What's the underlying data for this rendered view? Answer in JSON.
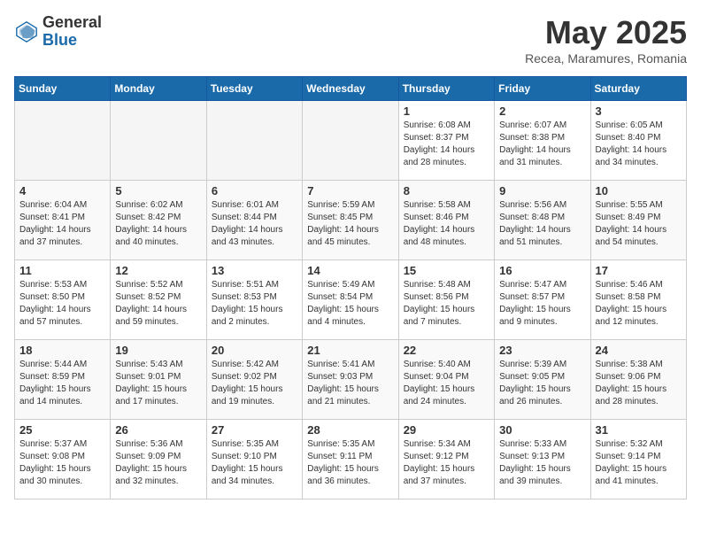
{
  "header": {
    "logo_general": "General",
    "logo_blue": "Blue",
    "month_year": "May 2025",
    "location": "Recea, Maramures, Romania"
  },
  "weekdays": [
    "Sunday",
    "Monday",
    "Tuesday",
    "Wednesday",
    "Thursday",
    "Friday",
    "Saturday"
  ],
  "weeks": [
    [
      {
        "day": "",
        "info": ""
      },
      {
        "day": "",
        "info": ""
      },
      {
        "day": "",
        "info": ""
      },
      {
        "day": "",
        "info": ""
      },
      {
        "day": "1",
        "info": "Sunrise: 6:08 AM\nSunset: 8:37 PM\nDaylight: 14 hours\nand 28 minutes."
      },
      {
        "day": "2",
        "info": "Sunrise: 6:07 AM\nSunset: 8:38 PM\nDaylight: 14 hours\nand 31 minutes."
      },
      {
        "day": "3",
        "info": "Sunrise: 6:05 AM\nSunset: 8:40 PM\nDaylight: 14 hours\nand 34 minutes."
      }
    ],
    [
      {
        "day": "4",
        "info": "Sunrise: 6:04 AM\nSunset: 8:41 PM\nDaylight: 14 hours\nand 37 minutes."
      },
      {
        "day": "5",
        "info": "Sunrise: 6:02 AM\nSunset: 8:42 PM\nDaylight: 14 hours\nand 40 minutes."
      },
      {
        "day": "6",
        "info": "Sunrise: 6:01 AM\nSunset: 8:44 PM\nDaylight: 14 hours\nand 43 minutes."
      },
      {
        "day": "7",
        "info": "Sunrise: 5:59 AM\nSunset: 8:45 PM\nDaylight: 14 hours\nand 45 minutes."
      },
      {
        "day": "8",
        "info": "Sunrise: 5:58 AM\nSunset: 8:46 PM\nDaylight: 14 hours\nand 48 minutes."
      },
      {
        "day": "9",
        "info": "Sunrise: 5:56 AM\nSunset: 8:48 PM\nDaylight: 14 hours\nand 51 minutes."
      },
      {
        "day": "10",
        "info": "Sunrise: 5:55 AM\nSunset: 8:49 PM\nDaylight: 14 hours\nand 54 minutes."
      }
    ],
    [
      {
        "day": "11",
        "info": "Sunrise: 5:53 AM\nSunset: 8:50 PM\nDaylight: 14 hours\nand 57 minutes."
      },
      {
        "day": "12",
        "info": "Sunrise: 5:52 AM\nSunset: 8:52 PM\nDaylight: 14 hours\nand 59 minutes."
      },
      {
        "day": "13",
        "info": "Sunrise: 5:51 AM\nSunset: 8:53 PM\nDaylight: 15 hours\nand 2 minutes."
      },
      {
        "day": "14",
        "info": "Sunrise: 5:49 AM\nSunset: 8:54 PM\nDaylight: 15 hours\nand 4 minutes."
      },
      {
        "day": "15",
        "info": "Sunrise: 5:48 AM\nSunset: 8:56 PM\nDaylight: 15 hours\nand 7 minutes."
      },
      {
        "day": "16",
        "info": "Sunrise: 5:47 AM\nSunset: 8:57 PM\nDaylight: 15 hours\nand 9 minutes."
      },
      {
        "day": "17",
        "info": "Sunrise: 5:46 AM\nSunset: 8:58 PM\nDaylight: 15 hours\nand 12 minutes."
      }
    ],
    [
      {
        "day": "18",
        "info": "Sunrise: 5:44 AM\nSunset: 8:59 PM\nDaylight: 15 hours\nand 14 minutes."
      },
      {
        "day": "19",
        "info": "Sunrise: 5:43 AM\nSunset: 9:01 PM\nDaylight: 15 hours\nand 17 minutes."
      },
      {
        "day": "20",
        "info": "Sunrise: 5:42 AM\nSunset: 9:02 PM\nDaylight: 15 hours\nand 19 minutes."
      },
      {
        "day": "21",
        "info": "Sunrise: 5:41 AM\nSunset: 9:03 PM\nDaylight: 15 hours\nand 21 minutes."
      },
      {
        "day": "22",
        "info": "Sunrise: 5:40 AM\nSunset: 9:04 PM\nDaylight: 15 hours\nand 24 minutes."
      },
      {
        "day": "23",
        "info": "Sunrise: 5:39 AM\nSunset: 9:05 PM\nDaylight: 15 hours\nand 26 minutes."
      },
      {
        "day": "24",
        "info": "Sunrise: 5:38 AM\nSunset: 9:06 PM\nDaylight: 15 hours\nand 28 minutes."
      }
    ],
    [
      {
        "day": "25",
        "info": "Sunrise: 5:37 AM\nSunset: 9:08 PM\nDaylight: 15 hours\nand 30 minutes."
      },
      {
        "day": "26",
        "info": "Sunrise: 5:36 AM\nSunset: 9:09 PM\nDaylight: 15 hours\nand 32 minutes."
      },
      {
        "day": "27",
        "info": "Sunrise: 5:35 AM\nSunset: 9:10 PM\nDaylight: 15 hours\nand 34 minutes."
      },
      {
        "day": "28",
        "info": "Sunrise: 5:35 AM\nSunset: 9:11 PM\nDaylight: 15 hours\nand 36 minutes."
      },
      {
        "day": "29",
        "info": "Sunrise: 5:34 AM\nSunset: 9:12 PM\nDaylight: 15 hours\nand 37 minutes."
      },
      {
        "day": "30",
        "info": "Sunrise: 5:33 AM\nSunset: 9:13 PM\nDaylight: 15 hours\nand 39 minutes."
      },
      {
        "day": "31",
        "info": "Sunrise: 5:32 AM\nSunset: 9:14 PM\nDaylight: 15 hours\nand 41 minutes."
      }
    ]
  ]
}
